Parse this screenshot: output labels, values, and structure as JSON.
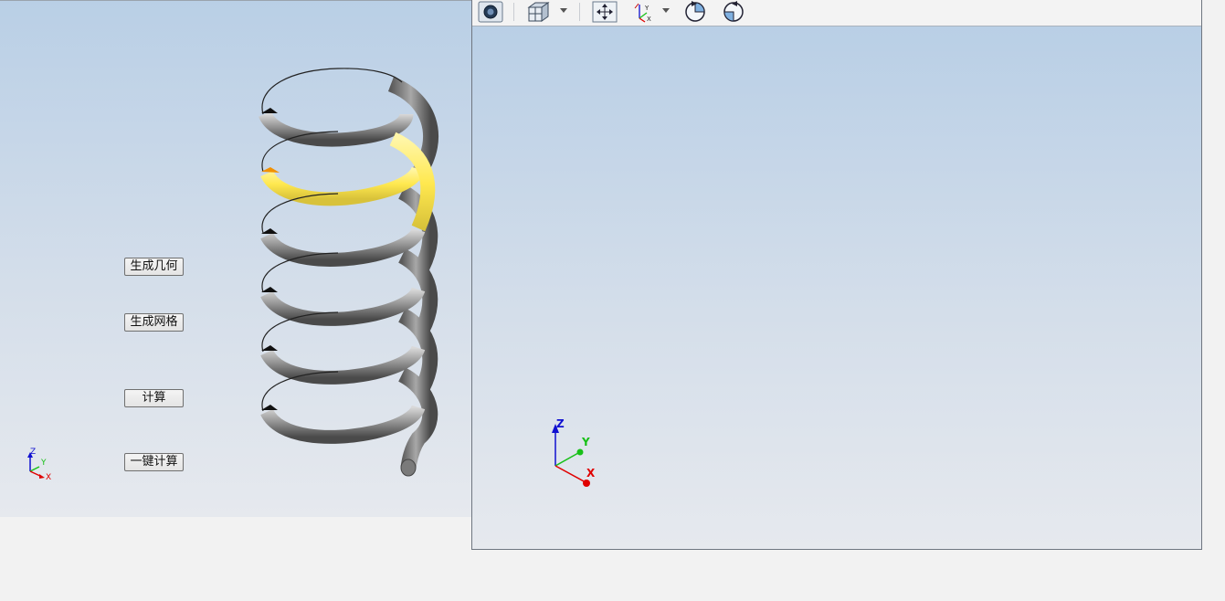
{
  "left_panel": {
    "buttons": [
      {
        "label": "生成几何"
      },
      {
        "label": "生成网格"
      },
      {
        "label": "计算"
      },
      {
        "label": "一键计算"
      }
    ],
    "triad": {
      "x": "X",
      "y": "Y",
      "z": "Z"
    }
  },
  "right_panel": {
    "toolbar": [
      {
        "icon": "camera-icon"
      },
      {
        "icon": "view-cube-icon"
      },
      {
        "icon": "fit-all-icon"
      },
      {
        "icon": "axes-view-icon"
      },
      {
        "icon": "rotate-left-icon"
      },
      {
        "icon": "rotate-right-icon"
      }
    ],
    "triad": {
      "x": "X",
      "y": "Y",
      "z": "Z"
    }
  },
  "colors": {
    "spring_body": "#8c8c8c",
    "spring_highlight": "#ffef7a",
    "selection_accent": "#f29100",
    "axis_x": "#e00000",
    "axis_y": "#18c018",
    "axis_z": "#1010d0"
  }
}
